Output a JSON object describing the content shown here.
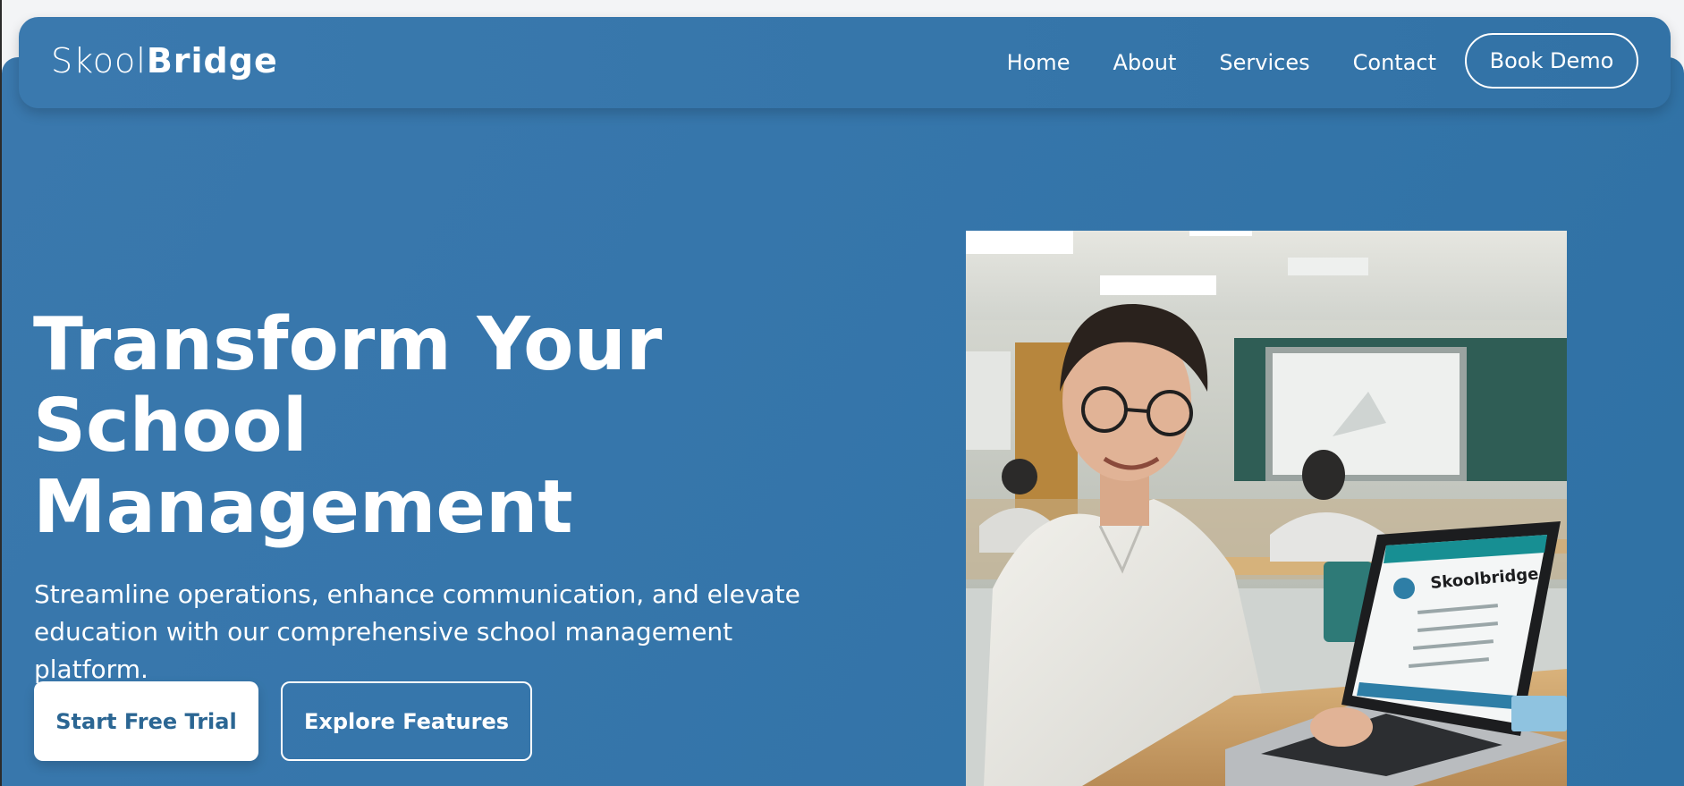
{
  "nav": {
    "logo_light": "Skool",
    "logo_bold": "Bridge",
    "links": [
      "Home",
      "About",
      "Services",
      "Contact"
    ],
    "cta": "Book Demo"
  },
  "hero": {
    "title_lines": [
      "Transform Your",
      "School",
      "Management"
    ],
    "subtitle_line1": "Streamline operations, enhance communication, and elevate",
    "subtitle_line2": "education with our comprehensive school management platform.",
    "primary_button": "Start Free Trial",
    "secondary_button": "Explore Features",
    "image_screen_text": "Skoolbridge"
  },
  "colors": {
    "brand_blue": "#3676ab",
    "primary_button_text": "#2b6693"
  }
}
